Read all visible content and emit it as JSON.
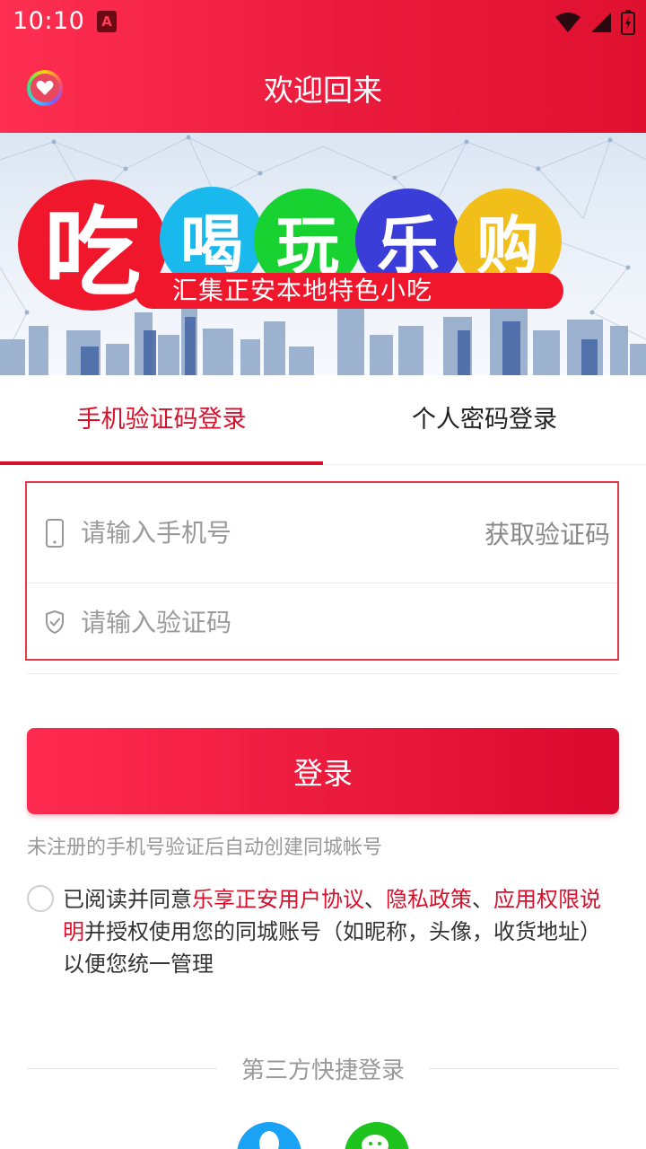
{
  "status_bar": {
    "time": "10:10",
    "notification_badge": "A"
  },
  "header": {
    "title": "欢迎回来",
    "gradient_colors": [
      "#ff2f52",
      "#e0102f"
    ]
  },
  "banner": {
    "characters": [
      "吃",
      "喝",
      "玩",
      "乐",
      "购"
    ],
    "slogan": "汇集正安本地特色小吃",
    "bubble_colors": [
      "#f0162b",
      "#19b9ee",
      "#18d232",
      "#3b3dd8",
      "#f2be1a"
    ]
  },
  "tabs": [
    {
      "label": "手机验证码登录",
      "active": true
    },
    {
      "label": "个人密码登录",
      "active": false
    }
  ],
  "form": {
    "phone_placeholder": "请输入手机号",
    "phone_value": "",
    "get_code_label": "获取验证码",
    "code_placeholder": "请输入验证码",
    "code_value": "",
    "phone_icon": "phone-icon",
    "code_icon": "shield-check-icon"
  },
  "login_button": "登录",
  "hint": "未注册的手机号验证后自动创建同城帐号",
  "agreement": {
    "checked": false,
    "prefix": "已阅读并同意",
    "link1": "乐享正安用户协议",
    "sep1": "、",
    "link2": "隐私政策",
    "sep2": "、",
    "link3": "应用权限说明",
    "suffix": "并授权使用您的同城账号（如昵称，头像，收货地址）以便您统一管理"
  },
  "third_party": {
    "label": "第三方快捷登录",
    "options": [
      {
        "name": "QQ",
        "icon": "qq-icon",
        "color": "#1aa3f5"
      },
      {
        "name": "WeChat",
        "icon": "wechat-icon",
        "color": "#1ec31e"
      }
    ]
  },
  "colors": {
    "accent": "#d8102c",
    "form_border": "#e23a48"
  }
}
